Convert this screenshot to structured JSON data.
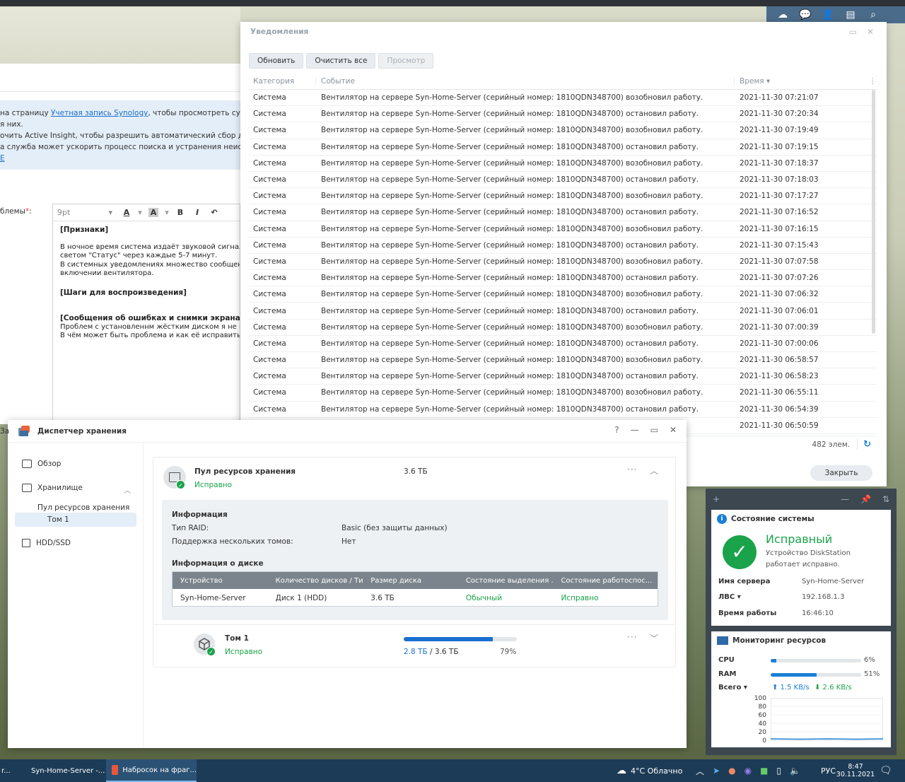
{
  "colors": {
    "accent": "#1a7fd6",
    "ok": "#1aa34a",
    "taskbar": "#1c3b56"
  },
  "dsm_tray": {
    "icons": [
      "cloud-sync-icon",
      "chat-icon",
      "user-icon",
      "widgets-icon",
      "search-icon"
    ]
  },
  "support_form": {
    "info_lines": [
      {
        "pre": "на страницу ",
        "link": "Учетная запись Synology",
        "post": ", чтобы просмотреть сущ"
      },
      {
        "pre": "я них.",
        "link": "",
        "post": ""
      },
      {
        "pre": "очить Active Insight, чтобы разрешить автоматический сбор да",
        "link": "",
        "post": ""
      },
      {
        "pre": "а служба может ускорить процесс поиска и устранения неиспр",
        "link": "",
        "post": ""
      },
      {
        "pre": "",
        "link": "E",
        "post": ""
      }
    ],
    "problem_label": "блемы",
    "required_mark": "*",
    "problem_colon": ":",
    "font_size": "9pt",
    "toolbar": {
      "font_color": "A",
      "bg_color": "A",
      "bold": "B",
      "italic": "I",
      "undo": "↶"
    },
    "body": {
      "h1": "[Признаки]",
      "p1": [
        "В ночное время система издаёт звуковой сигнал и",
        "светом \"Статус\" через каждые 5-7 минут.",
        "В системных уведомлениях множество сообщений",
        "включении вентилятора."
      ],
      "h2": "[Шаги для воспроизведения]",
      "h3": "[Сообщения об ошибках и снимки экрана]",
      "p3": [
        "Проблем с установленнм жёстким диском я не наб",
        "В чём может быть проблема и как её исправить?"
      ]
    },
    "side_label": "За"
  },
  "notifications": {
    "title": "Уведомления",
    "buttons": {
      "refresh": "Обновить",
      "clear_all": "Очистить все",
      "view": "Просмотр"
    },
    "columns": {
      "category": "Категория",
      "event": "Событие",
      "time": "Время ▾"
    },
    "rows": [
      {
        "category": "Система",
        "event": "Вентилятор на сервере Syn-Home-Server (серийный номер: 1810QDN348700) возобновил работу.",
        "time": "2021-11-30 07:21:07"
      },
      {
        "category": "Система",
        "event": "Вентилятор на сервере Syn-Home-Server (серийный номер: 1810QDN348700) остановил работу.",
        "time": "2021-11-30 07:20:34"
      },
      {
        "category": "Система",
        "event": "Вентилятор на сервере Syn-Home-Server (серийный номер: 1810QDN348700) возобновил работу.",
        "time": "2021-11-30 07:19:49"
      },
      {
        "category": "Система",
        "event": "Вентилятор на сервере Syn-Home-Server (серийный номер: 1810QDN348700) остановил работу.",
        "time": "2021-11-30 07:19:15"
      },
      {
        "category": "Система",
        "event": "Вентилятор на сервере Syn-Home-Server (серийный номер: 1810QDN348700) возобновил работу.",
        "time": "2021-11-30 07:18:37"
      },
      {
        "category": "Система",
        "event": "Вентилятор на сервере Syn-Home-Server (серийный номер: 1810QDN348700) остановил работу.",
        "time": "2021-11-30 07:18:03"
      },
      {
        "category": "Система",
        "event": "Вентилятор на сервере Syn-Home-Server (серийный номер: 1810QDN348700) возобновил работу.",
        "time": "2021-11-30 07:17:27"
      },
      {
        "category": "Система",
        "event": "Вентилятор на сервере Syn-Home-Server (серийный номер: 1810QDN348700) остановил работу.",
        "time": "2021-11-30 07:16:52"
      },
      {
        "category": "Система",
        "event": "Вентилятор на сервере Syn-Home-Server (серийный номер: 1810QDN348700) возобновил работу.",
        "time": "2021-11-30 07:16:15"
      },
      {
        "category": "Система",
        "event": "Вентилятор на сервере Syn-Home-Server (серийный номер: 1810QDN348700) остановил работу.",
        "time": "2021-11-30 07:15:43"
      },
      {
        "category": "Система",
        "event": "Вентилятор на сервере Syn-Home-Server (серийный номер: 1810QDN348700) возобновил работу.",
        "time": "2021-11-30 07:07:58"
      },
      {
        "category": "Система",
        "event": "Вентилятор на сервере Syn-Home-Server (серийный номер: 1810QDN348700) остановил работу.",
        "time": "2021-11-30 07:07:26"
      },
      {
        "category": "Система",
        "event": "Вентилятор на сервере Syn-Home-Server (серийный номер: 1810QDN348700) возобновил работу.",
        "time": "2021-11-30 07:06:32"
      },
      {
        "category": "Система",
        "event": "Вентилятор на сервере Syn-Home-Server (серийный номер: 1810QDN348700) остановил работу.",
        "time": "2021-11-30 07:06:01"
      },
      {
        "category": "Система",
        "event": "Вентилятор на сервере Syn-Home-Server (серийный номер: 1810QDN348700) возобновил работу.",
        "time": "2021-11-30 07:00:39"
      },
      {
        "category": "Система",
        "event": "Вентилятор на сервере Syn-Home-Server (серийный номер: 1810QDN348700) остановил работу.",
        "time": "2021-11-30 07:00:06"
      },
      {
        "category": "Система",
        "event": "Вентилятор на сервере Syn-Home-Server (серийный номер: 1810QDN348700) возобновил работу.",
        "time": "2021-11-30 06:58:57"
      },
      {
        "category": "Система",
        "event": "Вентилятор на сервере Syn-Home-Server (серийный номер: 1810QDN348700) остановил работу.",
        "time": "2021-11-30 06:58:23"
      },
      {
        "category": "Система",
        "event": "Вентилятор на сервере Syn-Home-Server (серийный номер: 1810QDN348700) возобновил работу.",
        "time": "2021-11-30 06:55:11"
      },
      {
        "category": "Система",
        "event": "Вентилятор на сервере Syn-Home-Server (серийный номер: 1810QDN348700) остановил работу.",
        "time": "2021-11-30 06:54:39"
      },
      {
        "category": "",
        "event": "ту.",
        "time": "2021-11-30 06:50:59"
      }
    ],
    "count": "482 элем.",
    "close": "Закрыть"
  },
  "storage": {
    "title": "Диспетчер хранения",
    "controls": {
      "help": "?",
      "minimize": "—",
      "maximize": "▭",
      "close": "✕"
    },
    "sidebar": {
      "overview": "Обзор",
      "storage": "Хранилище",
      "pool": "Пул ресурсов хранения",
      "volume": "Том 1",
      "hdd": "HDD/SSD"
    },
    "pool": {
      "title": "Пул ресурсов хранения",
      "status": "Исправно",
      "size": "3.6 ТБ",
      "info_header": "Информация",
      "raid_label": "Тип RAID:",
      "raid_value": "Basic (без защиты данных)",
      "multivol_label": "Поддержка нескольких томов:",
      "multivol_value": "Нет",
      "disk_info_header": "Информация о диске",
      "disk_columns": [
        "Устройство",
        "Количество дисков / Тип",
        "Размер диска",
        "Состояние выделения ...",
        "Состояние работоспос..."
      ],
      "disk_row": [
        "Syn-Home-Server",
        "Диск 1 (HDD)",
        "3.6 ТБ",
        "Обычный",
        "Исправно"
      ]
    },
    "volume": {
      "title": "Том 1",
      "status": "Исправно",
      "used": "2.8 ТБ",
      "sep": " / ",
      "total": "3.6 ТБ",
      "percent_text": "79%",
      "percent": 79
    }
  },
  "widgets": {
    "add": "+",
    "system": {
      "title": "Состояние системы",
      "status": "Исправный",
      "desc": "Устройство DiskStation работает исправно.",
      "server_label": "Имя сервера",
      "server_value": "Syn-Home-Server",
      "lan_label": "ЛВС ▾",
      "lan_value": "192.168.1.3",
      "uptime_label": "Время работы",
      "uptime_value": "16:46:10"
    },
    "resources": {
      "title": "Мониторинг ресурсов",
      "cpu_label": "CPU",
      "cpu_text": "6%",
      "cpu": 6,
      "ram_label": "RAM",
      "ram_text": "51%",
      "ram": 51,
      "total_label": "Всего ▾",
      "up": "⬆ 1.5 KB/s",
      "down": "⬇ 2.6 KB/s",
      "y_ticks": [
        "100",
        "80",
        "60",
        "40",
        "20",
        "0"
      ]
    }
  },
  "taskbar": {
    "left_stub": "r...",
    "app1": "Syn-Home-Server -...",
    "app2": "Набросок на фраг...",
    "weather": "4°C  Облачно",
    "lang": "РУС",
    "time": "8:47",
    "date": "30.11.2021"
  }
}
